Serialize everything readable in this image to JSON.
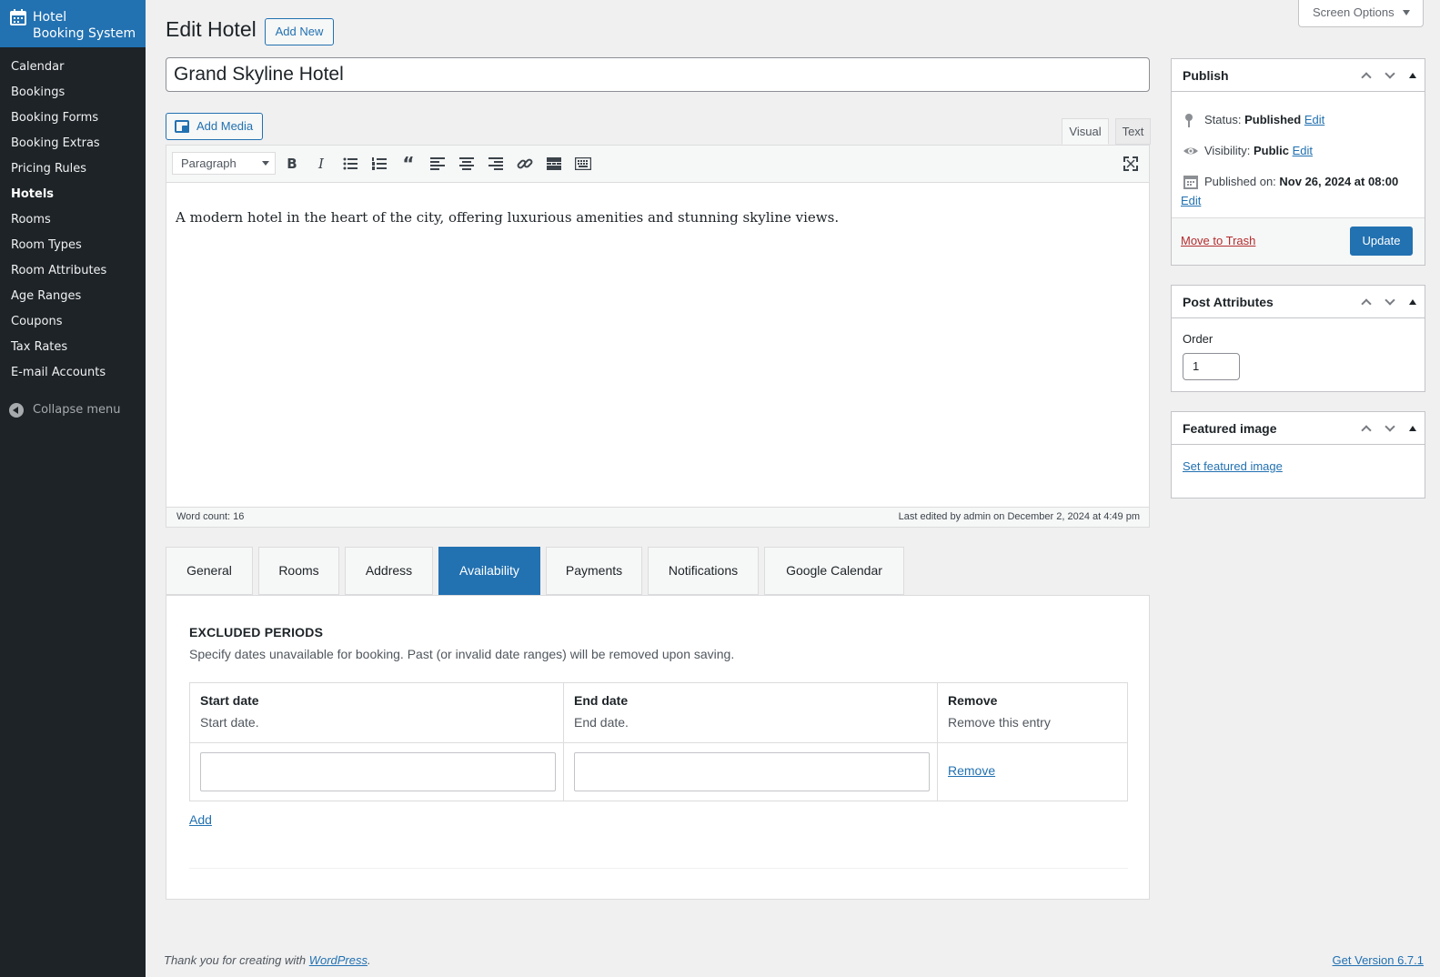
{
  "brand": {
    "line1": "Hotel",
    "line2": "Booking System",
    "icon": "calendar-icon"
  },
  "menu": [
    {
      "label": "Calendar"
    },
    {
      "label": "Bookings"
    },
    {
      "label": "Booking Forms"
    },
    {
      "label": "Booking Extras"
    },
    {
      "label": "Pricing Rules"
    },
    {
      "label": "Hotels",
      "current": true
    },
    {
      "label": "Rooms"
    },
    {
      "label": "Room Types"
    },
    {
      "label": "Room Attributes"
    },
    {
      "label": "Age Ranges"
    },
    {
      "label": "Coupons"
    },
    {
      "label": "Tax Rates"
    },
    {
      "label": "E-mail Accounts"
    }
  ],
  "collapse_label": "Collapse menu",
  "header": {
    "title": "Edit Hotel",
    "add_new": "Add New",
    "screen_options": "Screen Options"
  },
  "post": {
    "title": "Grand Skyline Hotel"
  },
  "editor": {
    "add_media": "Add Media",
    "tab_visual": "Visual",
    "tab_text": "Text",
    "format": "Paragraph",
    "content": "A modern hotel in the heart of the city, offering luxurious amenities and stunning skyline views.",
    "word_count": "Word count: 16",
    "last_edited": "Last edited by admin on December 2, 2024 at 4:49 pm"
  },
  "meta_tabs": [
    {
      "label": "General"
    },
    {
      "label": "Rooms"
    },
    {
      "label": "Address"
    },
    {
      "label": "Availability",
      "active": true
    },
    {
      "label": "Payments"
    },
    {
      "label": "Notifications"
    },
    {
      "label": "Google Calendar"
    }
  ],
  "availability": {
    "heading": "EXCLUDED PERIODS",
    "description": "Specify dates unavailable for booking. Past (or invalid date ranges) will be removed upon saving.",
    "columns": [
      {
        "title": "Start date",
        "desc": "Start date."
      },
      {
        "title": "End date",
        "desc": "End date."
      },
      {
        "title": "Remove",
        "desc": "Remove this entry"
      }
    ],
    "row": {
      "start": "",
      "end": "",
      "remove": "Remove"
    },
    "add": "Add"
  },
  "publish": {
    "title": "Publish",
    "status_label": "Status:",
    "status_value": "Published",
    "visibility_label": "Visibility:",
    "visibility_value": "Public",
    "published_label": "Published on:",
    "published_value": "Nov 26, 2024 at 08:00",
    "edit": "Edit",
    "trash": "Move to Trash",
    "update": "Update"
  },
  "attributes": {
    "title": "Post Attributes",
    "order_label": "Order",
    "order_value": "1"
  },
  "featured": {
    "title": "Featured image",
    "link": "Set featured image"
  },
  "footer": {
    "thanks_prefix": "Thank you for creating with ",
    "thanks_link": "WordPress",
    "thanks_suffix": ".",
    "version": "Get Version 6.7.1"
  },
  "colors": {
    "accent": "#2271b1",
    "sidebar": "#1d2327",
    "danger": "#b32d2e"
  }
}
